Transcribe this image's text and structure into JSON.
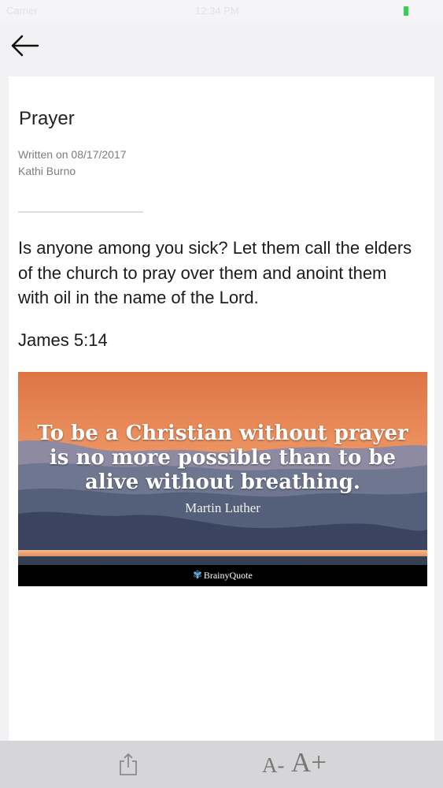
{
  "status_bar": {
    "carrier": "Carrier",
    "time": "12:34 PM",
    "battery_color": "#35d152"
  },
  "nav": {
    "back_icon": "arrow-left-icon"
  },
  "article": {
    "title": "Prayer",
    "date": "Written on 08/17/2017",
    "author": "Kathi Burno",
    "body": "Is anyone among you sick? Let them call the elders of the church to pray over them and anoint them with oil in the name of the Lord.",
    "reference": "James 5:14"
  },
  "quote_image": {
    "lines": [
      "To be a Christian without prayer",
      "is no more possible than to be",
      "alive without breathing."
    ],
    "author": "Martin Luther",
    "brand": "BrainyQuote",
    "sky_top": "#e0784a",
    "sky_bottom": "#f6b38a"
  },
  "toolbar": {
    "share_icon": "share-icon",
    "decrease_label": "A-",
    "increase_label": "A+"
  }
}
